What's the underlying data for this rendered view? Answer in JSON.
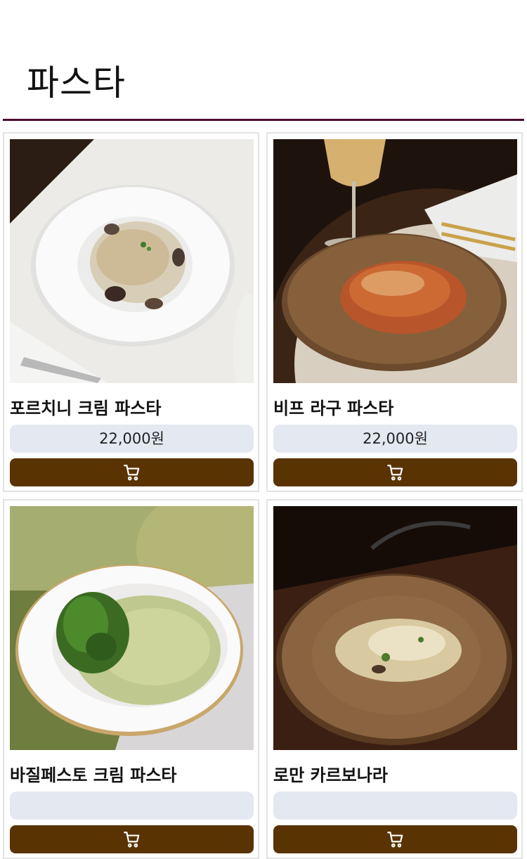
{
  "category": {
    "title": "파스타"
  },
  "icons": {
    "cart": "shopping-cart-icon"
  },
  "colors": {
    "divider": "#4a0a2e",
    "cart_button": "#5a3302",
    "price_bg": "#e3e8f1"
  },
  "products": [
    {
      "name": "포르치니 크림 파스타",
      "price": "22,000원"
    },
    {
      "name": "비프 라구 파스타",
      "price": "22,000원"
    },
    {
      "name": "바질페스토 크림 파스타",
      "price": ""
    },
    {
      "name": "로만 카르보나라",
      "price": ""
    }
  ]
}
